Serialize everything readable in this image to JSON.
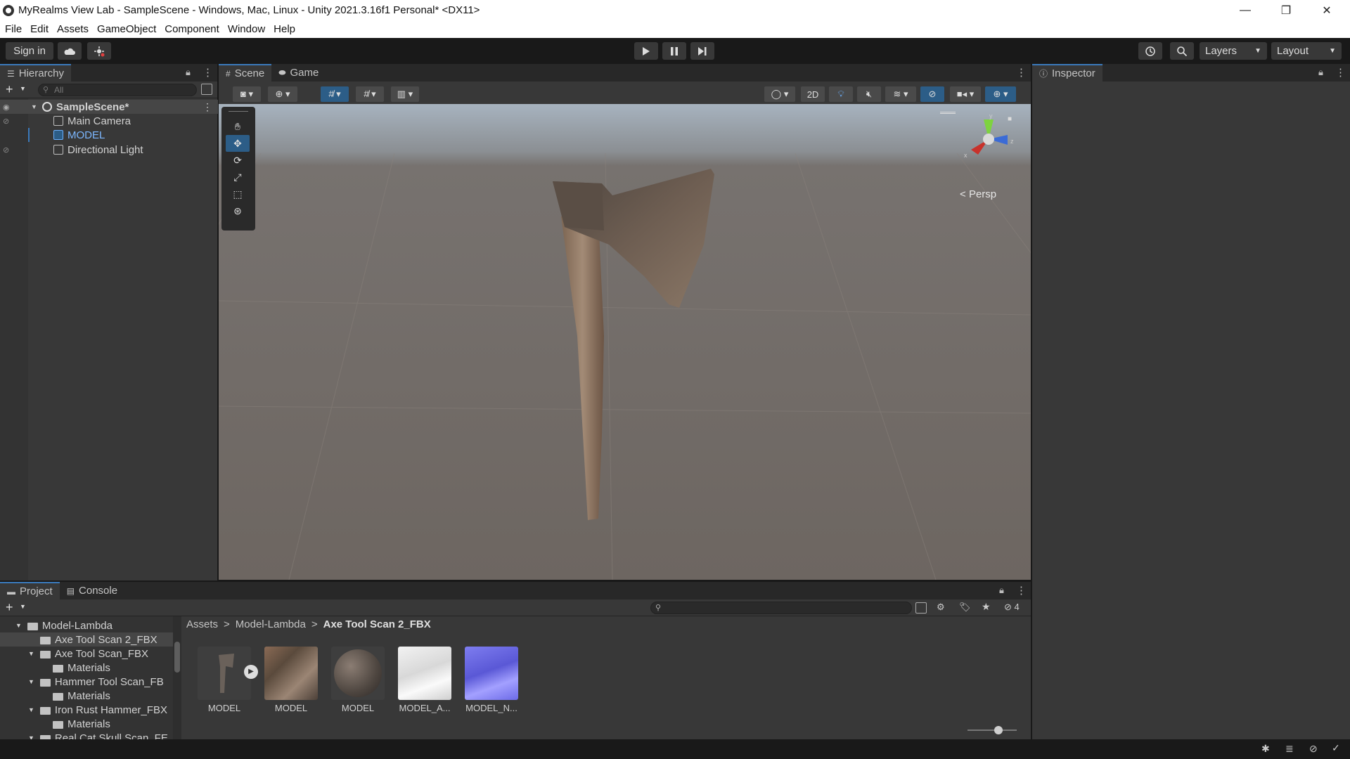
{
  "window": {
    "title": "MyRealms View Lab - SampleScene - Windows, Mac, Linux - Unity 2021.3.16f1 Personal* <DX11>",
    "minimize": "—",
    "restore": "❐",
    "close": "✕"
  },
  "menu": [
    "File",
    "Edit",
    "Assets",
    "GameObject",
    "Component",
    "Window",
    "Help"
  ],
  "toolbar": {
    "sign_in": "Sign in",
    "layers": "Layers",
    "layout": "Layout"
  },
  "hierarchy": {
    "tab": "Hierarchy",
    "search_placeholder": "All",
    "scene": "SampleScene*",
    "items": [
      "Main Camera",
      "MODEL",
      "Directional Light"
    ]
  },
  "scene_tabs": {
    "scene": "Scene",
    "game": "Game",
    "btn_2d": "2D",
    "persp": "Persp"
  },
  "inspector": {
    "tab": "Inspector"
  },
  "bottom_tabs": {
    "project": "Project",
    "console": "Console",
    "hidden_count": "4"
  },
  "project_tree": {
    "items": [
      "Model-Lambda",
      "Axe Tool Scan 2_FBX",
      "Axe Tool Scan_FBX",
      "Materials",
      "Hammer Tool Scan_FB",
      "Materials",
      "Iron Rust Hammer_FBX",
      "Materials",
      "Real Cat Skull Scan_FE"
    ]
  },
  "breadcrumb": {
    "a": "Assets",
    "b": "Model-Lambda",
    "c": "Axe Tool Scan 2_FBX"
  },
  "assets": [
    "MODEL",
    "MODEL",
    "MODEL",
    "MODEL_A...",
    "MODEL_N..."
  ],
  "colors": {
    "accent": "#3a79bb",
    "selection": "#2c5d87"
  }
}
